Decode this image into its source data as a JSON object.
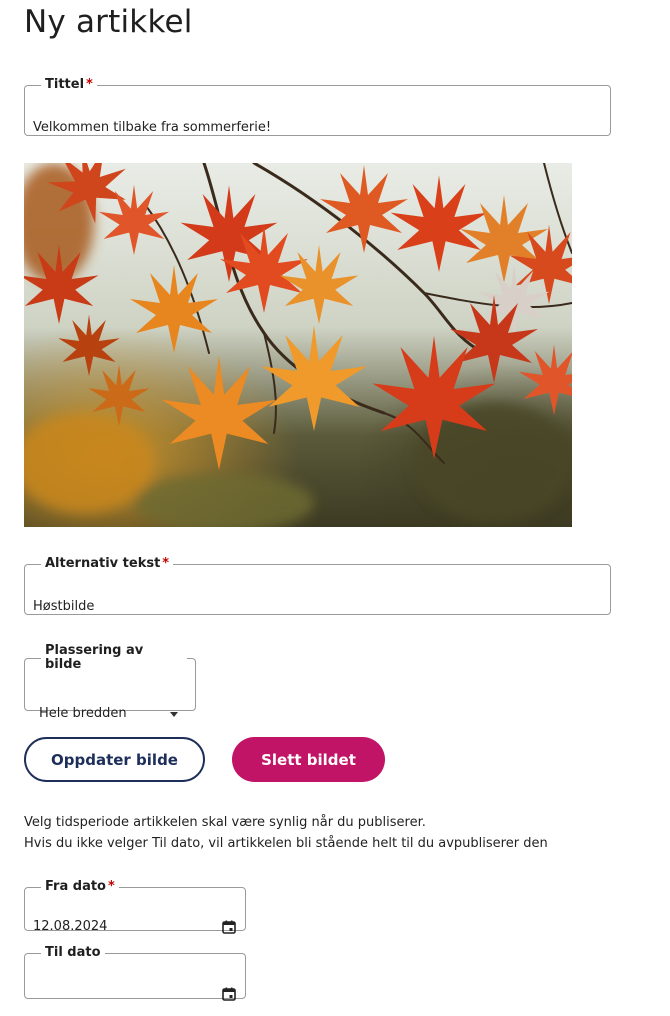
{
  "page": {
    "title": "Ny artikkel"
  },
  "fields": {
    "title": {
      "label": "Tittel",
      "required_mark": "*",
      "value": "Velkommen tilbake fra sommerferie!"
    },
    "alt_text": {
      "label": "Alternativ tekst",
      "required_mark": "*",
      "value": "Høstbilde"
    },
    "image_placement": {
      "label": "Plassering av bilde",
      "selected": "Hele bredden",
      "icon": "chevron-down-icon"
    },
    "from_date": {
      "label": "Fra dato",
      "required_mark": "*",
      "value": "12.08.2024",
      "icon": "calendar-icon"
    },
    "to_date": {
      "label": "Til dato",
      "value": "",
      "icon": "calendar-icon"
    }
  },
  "image": {
    "subject": "autumn maple leaves"
  },
  "buttons": {
    "update_image": "Oppdater bilde",
    "delete_image": "Slett bildet"
  },
  "info": {
    "line1": "Velg tidsperiode artikkelen skal være synlig når du publiserer.",
    "line2": "Hvis du ikke velger Til dato, vil artikkelen bli stående helt til du avpubliserer den"
  },
  "colors": {
    "primary": "#1d2e5a",
    "danger": "#c21466",
    "required": "#c40000",
    "border": "#9a9a9a"
  }
}
